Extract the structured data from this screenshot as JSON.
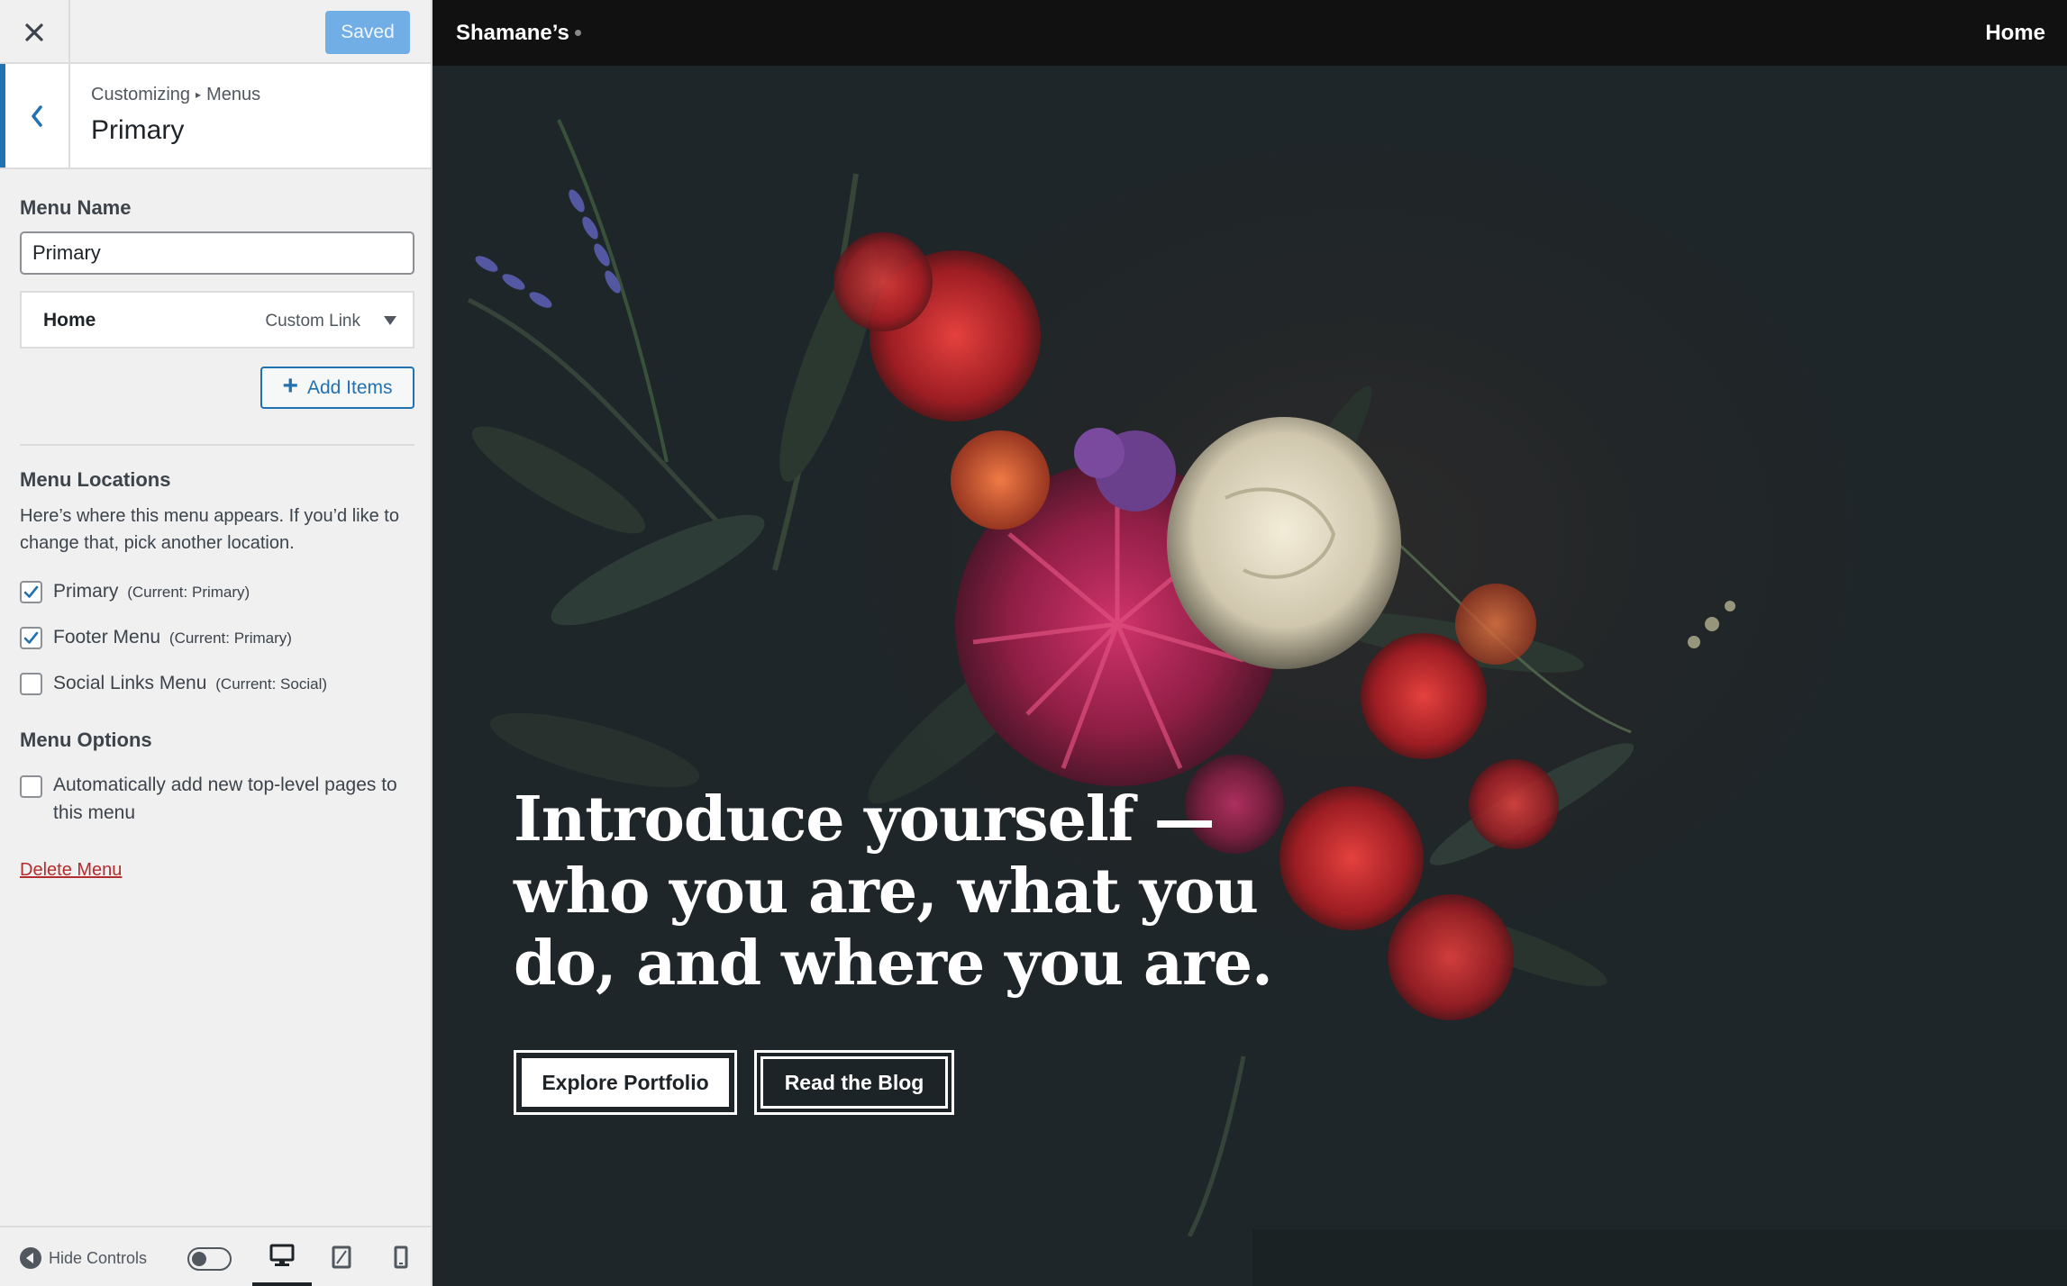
{
  "customizer": {
    "close_icon": "close-icon",
    "saved_label": "Saved",
    "breadcrumb": {
      "root": "Customizing",
      "section": "Menus"
    },
    "panel_title": "Primary",
    "menu_name_label": "Menu Name",
    "menu_name_value": "Primary",
    "menu_items": [
      {
        "title": "Home",
        "type": "Custom Link"
      }
    ],
    "add_items_label": "Add Items",
    "locations_heading": "Menu Locations",
    "locations_description": "Here’s where this menu appears. If you’d like to change that, pick another location.",
    "locations": [
      {
        "label": "Primary",
        "current": "(Current: Primary)",
        "checked": true
      },
      {
        "label": "Footer Menu",
        "current": "(Current: Primary)",
        "checked": true
      },
      {
        "label": "Social Links Menu",
        "current": "(Current: Social)",
        "checked": false
      }
    ],
    "options_heading": "Menu Options",
    "auto_add_label": "Automatically add new top-level pages to this menu",
    "auto_add_checked": false,
    "delete_label": "Delete Menu",
    "footer": {
      "hide_controls_label": "Hide Controls",
      "devices": [
        "desktop-icon",
        "tablet-icon",
        "mobile-icon"
      ],
      "active_device": "desktop"
    }
  },
  "preview": {
    "site_title": "Shamane’s",
    "nav": [
      "Home"
    ],
    "hero_heading": "Introduce yourself — who you are, what you do, and where you are.",
    "buttons": {
      "primary": "Explore Portfolio",
      "secondary": "Read the Blog"
    }
  },
  "colors": {
    "accent": "#2271b1",
    "saved_button": "#72aee6",
    "delete_link": "#b32d2e",
    "preview_background": "#1e2629"
  }
}
